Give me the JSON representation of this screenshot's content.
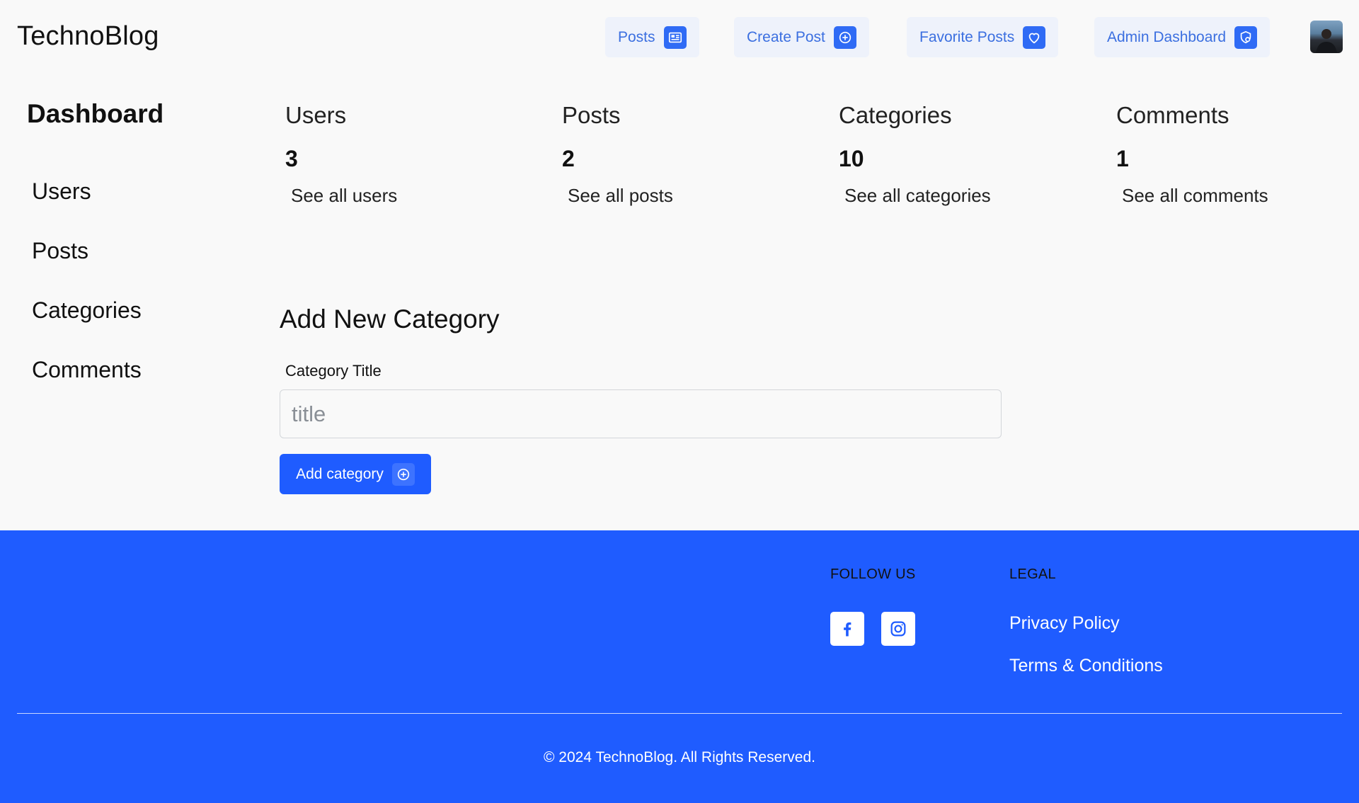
{
  "navbar": {
    "brand": "TechnoBlog",
    "buttons": [
      {
        "label": "Posts",
        "icon": "newspaper-icon"
      },
      {
        "label": "Create Post",
        "icon": "plus-circle-icon"
      },
      {
        "label": "Favorite Posts",
        "icon": "heart-icon"
      },
      {
        "label": "Admin Dashboard",
        "icon": "admin-shield-icon"
      }
    ]
  },
  "sidebar": {
    "title": "Dashboard",
    "items": [
      {
        "label": "Users"
      },
      {
        "label": "Posts"
      },
      {
        "label": "Categories"
      },
      {
        "label": "Comments"
      }
    ]
  },
  "stats": [
    {
      "label": "Users",
      "value": "3",
      "link": "See all users"
    },
    {
      "label": "Posts",
      "value": "2",
      "link": "See all posts"
    },
    {
      "label": "Categories",
      "value": "10",
      "link": "See all categories"
    },
    {
      "label": "Comments",
      "value": "1",
      "link": "See all comments"
    }
  ],
  "form": {
    "title": "Add New Category",
    "label": "Category Title",
    "placeholder": "title",
    "value": "",
    "button_label": "Add category"
  },
  "footer": {
    "follow_heading": "FOLLOW US",
    "legal_heading": "LEGAL",
    "social": [
      {
        "icon": "facebook-icon"
      },
      {
        "icon": "instagram-icon"
      }
    ],
    "legal_links": [
      {
        "label": "Privacy Policy"
      },
      {
        "label": "Terms & Conditions"
      }
    ],
    "copyright": "© 2024 TechnoBlog. All Rights Reserved."
  },
  "colors": {
    "primary": "#1f5cff",
    "nav_button_bg": "#eef2fb",
    "nav_button_text": "#3b6fe0",
    "background": "#f9f9f9"
  }
}
